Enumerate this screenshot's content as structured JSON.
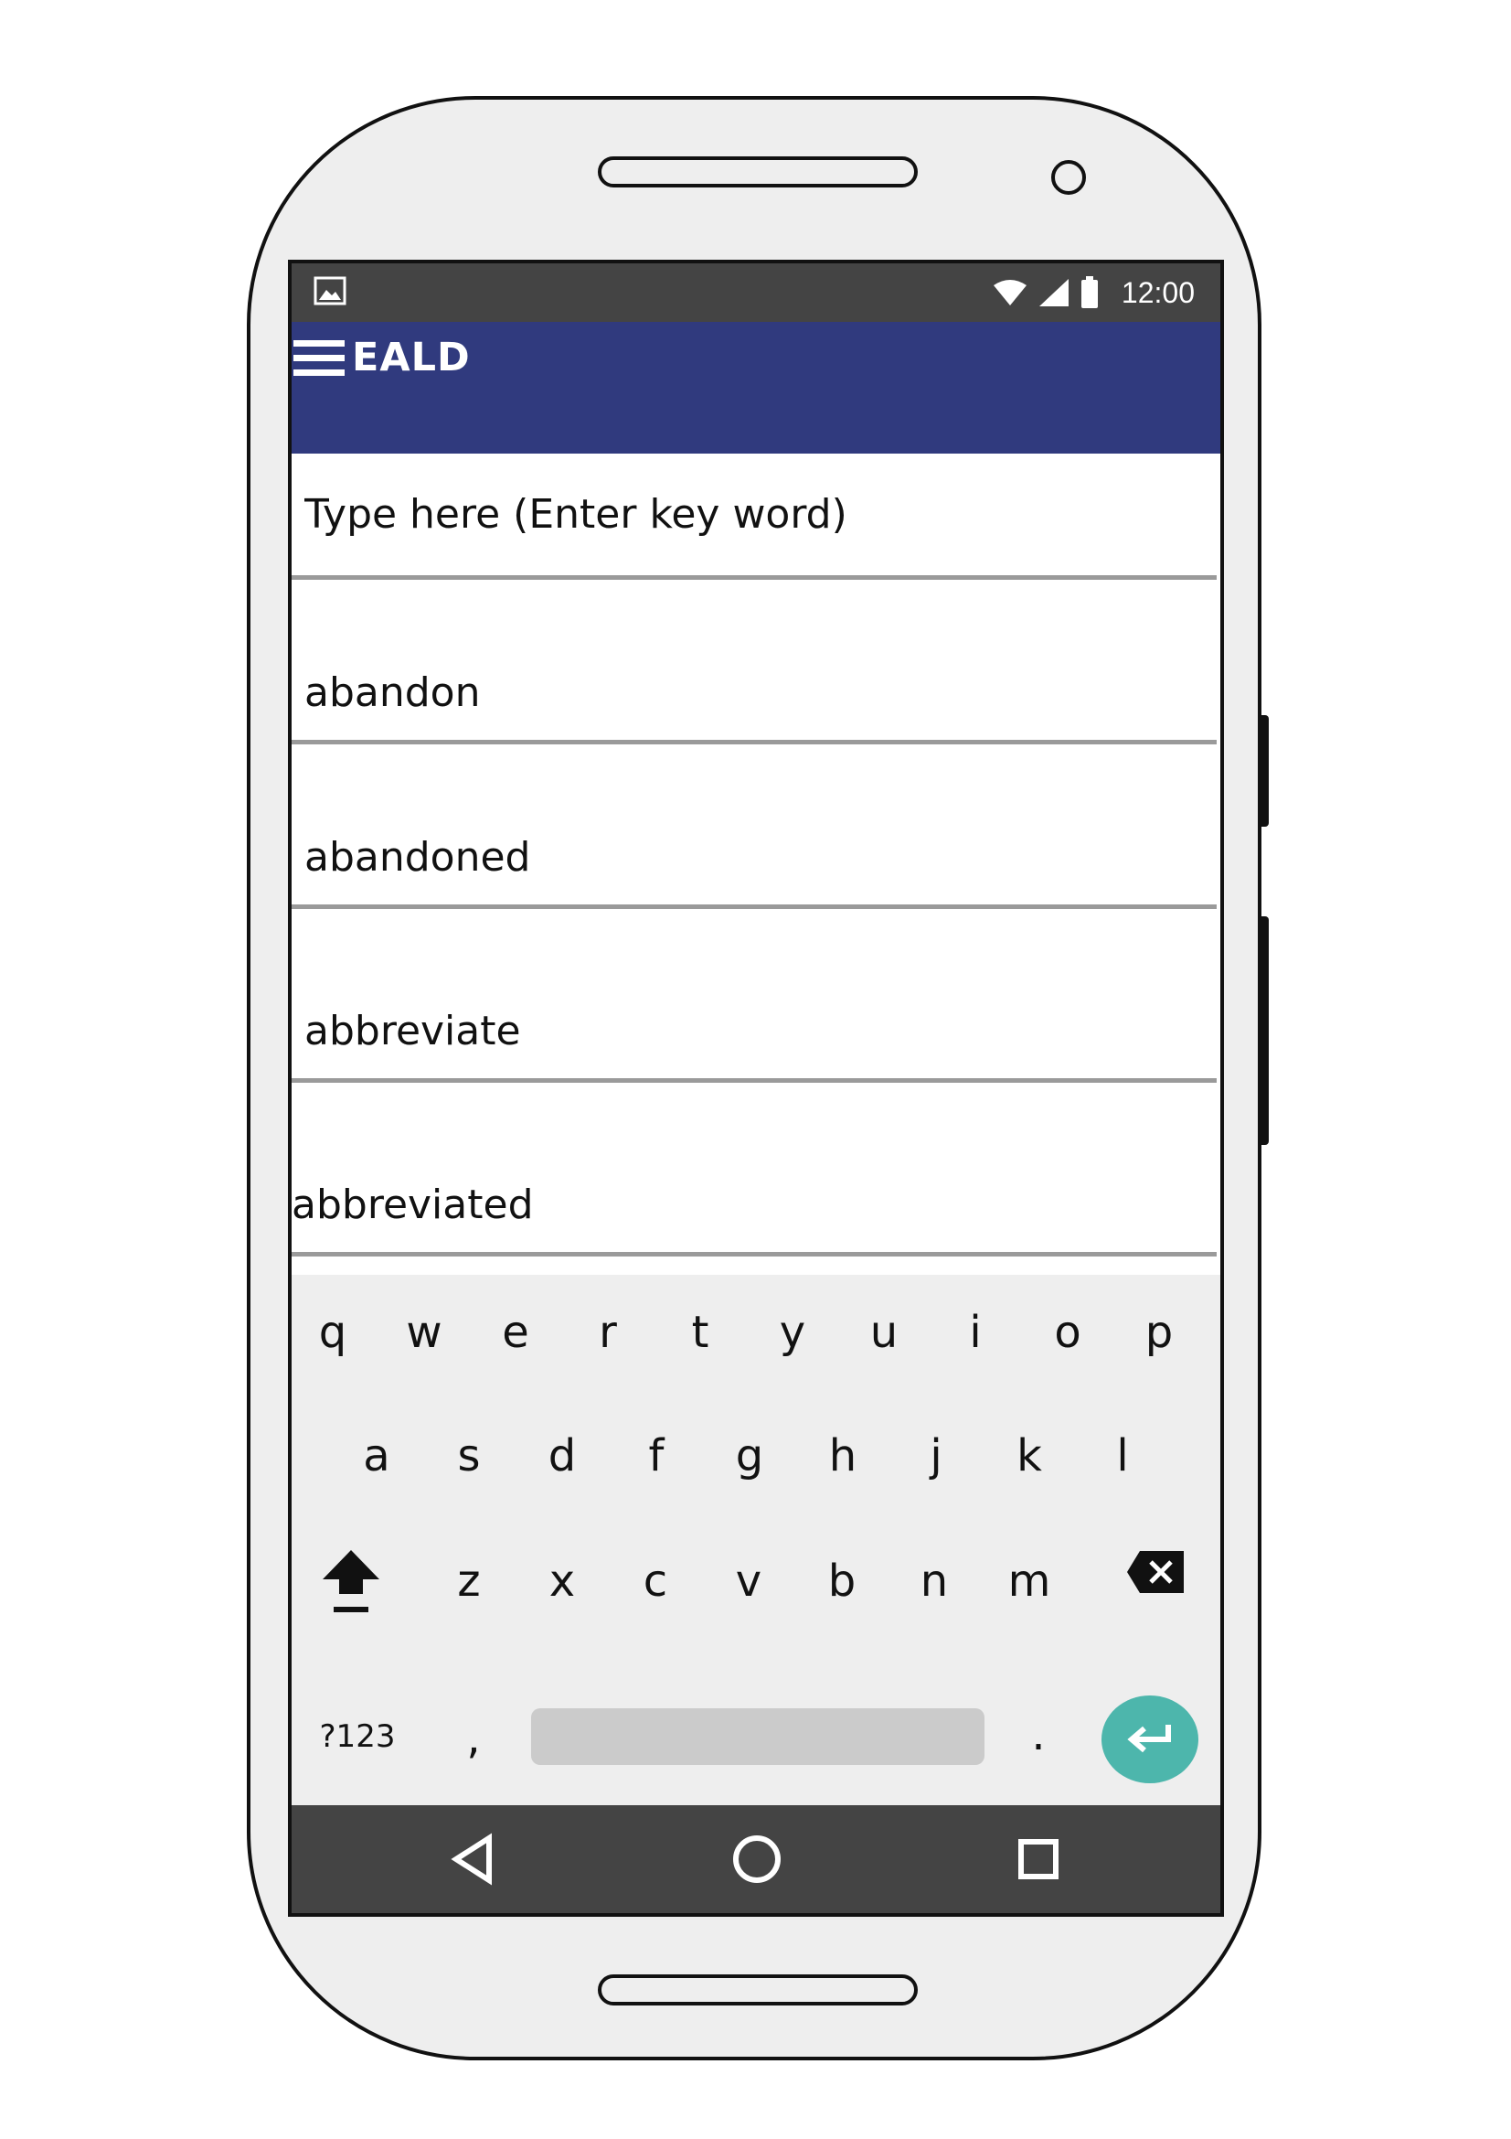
{
  "status_bar": {
    "time": "12:00",
    "icons": [
      "image-icon",
      "wifi-icon",
      "signal-icon",
      "battery-icon"
    ]
  },
  "app_bar": {
    "title": "EALD",
    "menu_icon": "menu-icon",
    "color": "#303a7e"
  },
  "search": {
    "placeholder": "Type here (Enter key word)",
    "value": ""
  },
  "words": [
    "abandon",
    "abandoned",
    "abbreviate",
    "abbreviated"
  ],
  "keyboard": {
    "row1": [
      "q",
      "w",
      "e",
      "r",
      "t",
      "y",
      "u",
      "i",
      "o",
      "p"
    ],
    "row2": [
      "a",
      "s",
      "d",
      "f",
      "g",
      "h",
      "j",
      "k",
      "l"
    ],
    "row3": [
      "z",
      "x",
      "c",
      "v",
      "b",
      "n",
      "m"
    ],
    "symbols_label": "?123",
    "comma": ",",
    "period": ".",
    "shift_icon": "shift-icon",
    "backspace_icon": "backspace-icon",
    "enter_icon": "enter-icon",
    "enter_color": "#4db6ac"
  },
  "nav_bar": {
    "icons": [
      "back-icon",
      "home-icon",
      "recents-icon"
    ]
  }
}
